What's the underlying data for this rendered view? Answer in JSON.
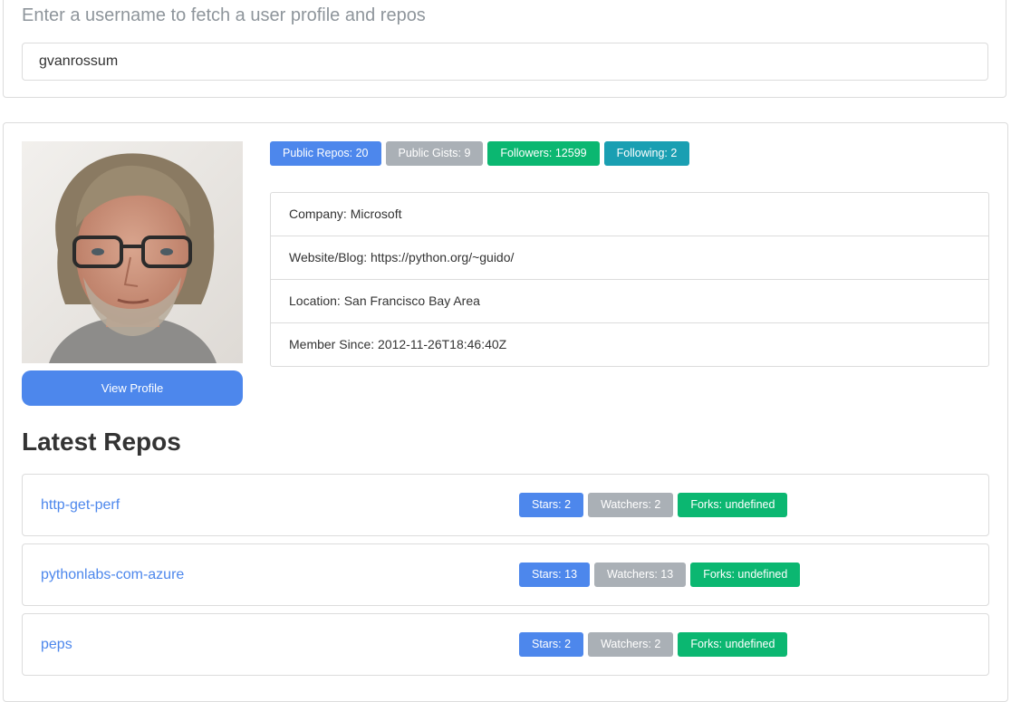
{
  "search": {
    "subtitle": "Enter a username to fetch a user profile and repos",
    "value": "gvanrossum"
  },
  "colors": {
    "primary": "#4d87ec",
    "secondary": "#aab0b6",
    "success": "#0bb771",
    "info": "#1a9fb2"
  },
  "profile": {
    "view_profile_label": "View Profile",
    "badges": [
      {
        "label": "Public Repos: 20",
        "color": "#4d87ec"
      },
      {
        "label": "Public Gists: 9",
        "color": "#aab0b6"
      },
      {
        "label": "Followers: 12599",
        "color": "#0bb771"
      },
      {
        "label": "Following: 2",
        "color": "#1a9fb2"
      }
    ],
    "info": [
      {
        "label": "Company: Microsoft"
      },
      {
        "label": "Website/Blog: https://python.org/~guido/"
      },
      {
        "label": "Location: San Francisco Bay Area"
      },
      {
        "label": "Member Since: 2012-11-26T18:46:40Z"
      }
    ]
  },
  "repos": {
    "heading": "Latest Repos",
    "items": [
      {
        "name": "http-get-perf",
        "stars": "Stars: 2",
        "watchers": "Watchers: 2",
        "forks": "Forks: undefined"
      },
      {
        "name": "pythonlabs-com-azure",
        "stars": "Stars: 13",
        "watchers": "Watchers: 13",
        "forks": "Forks: undefined"
      },
      {
        "name": "peps",
        "stars": "Stars: 2",
        "watchers": "Watchers: 2",
        "forks": "Forks: undefined"
      }
    ]
  }
}
